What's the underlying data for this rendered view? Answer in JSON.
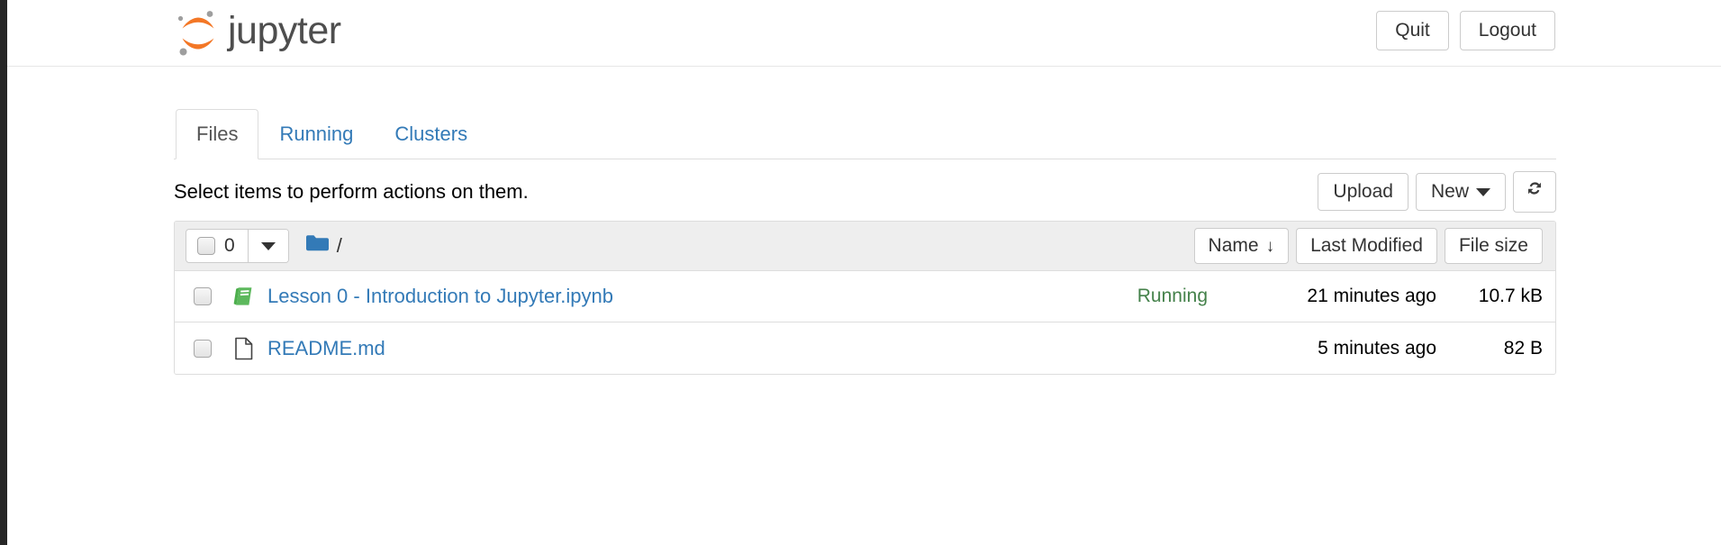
{
  "header": {
    "logo_text": "jupyter",
    "logo_icon": "jupyter-logo-icon",
    "quit_label": "Quit",
    "logout_label": "Logout",
    "accent_orange": "#f37726",
    "logo_gray": "#4e4e4e"
  },
  "tabs": [
    {
      "label": "Files",
      "active": true
    },
    {
      "label": "Running",
      "active": false
    },
    {
      "label": "Clusters",
      "active": false
    }
  ],
  "toolbar": {
    "message": "Select items to perform actions on them.",
    "upload_label": "Upload",
    "new_label": "New",
    "new_caret_icon": "chevron-down-icon",
    "refresh_icon": "refresh-icon"
  },
  "list_header": {
    "selected_count": "0",
    "select_all_checkbox": "select-all-checkbox",
    "select_dropdown_icon": "chevron-down-icon",
    "folder_icon": "folder-icon",
    "breadcrumb_path": "/",
    "sort_name_label": "Name",
    "sort_name_arrow": "↓",
    "sort_modified_label": "Last Modified",
    "sort_size_label": "File size"
  },
  "files": [
    {
      "icon": "notebook-icon",
      "name": "Lesson 0 - Introduction to Jupyter.ipynb",
      "status": "Running",
      "modified": "21 minutes ago",
      "size": "10.7 kB"
    },
    {
      "icon": "file-icon",
      "name": "README.md",
      "status": "",
      "modified": "5 minutes ago",
      "size": "82 B"
    }
  ],
  "colors": {
    "link_blue": "#337ab7",
    "running_green": "#44814a",
    "notebook_green": "#5cb85c",
    "folder_blue": "#337ab7",
    "header_bg": "#eeeeee",
    "border": "#dddddd"
  }
}
